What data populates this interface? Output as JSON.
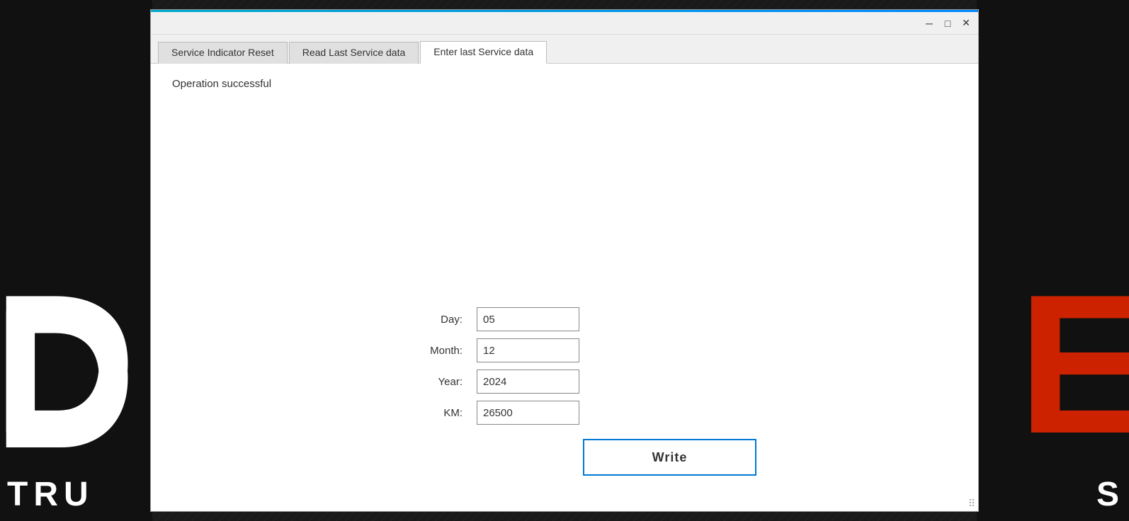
{
  "background": {
    "left_letter": "D",
    "left_text": "TRU",
    "right_letter": "E",
    "right_text": "S"
  },
  "window": {
    "controls": {
      "minimize": "─",
      "maximize": "□",
      "close": "✕"
    }
  },
  "tabs": [
    {
      "id": "tab-reset",
      "label": "Service Indicator Reset",
      "active": false
    },
    {
      "id": "tab-read",
      "label": "Read Last Service data",
      "active": false
    },
    {
      "id": "tab-enter",
      "label": "Enter last Service data",
      "active": true
    }
  ],
  "content": {
    "status": "Operation successful",
    "form": {
      "fields": [
        {
          "id": "day",
          "label": "Day:",
          "value": "05"
        },
        {
          "id": "month",
          "label": "Month:",
          "value": "12"
        },
        {
          "id": "year",
          "label": "Year:",
          "value": "2024"
        },
        {
          "id": "km",
          "label": "KM:",
          "value": "26500"
        }
      ],
      "write_button": "Write"
    }
  }
}
